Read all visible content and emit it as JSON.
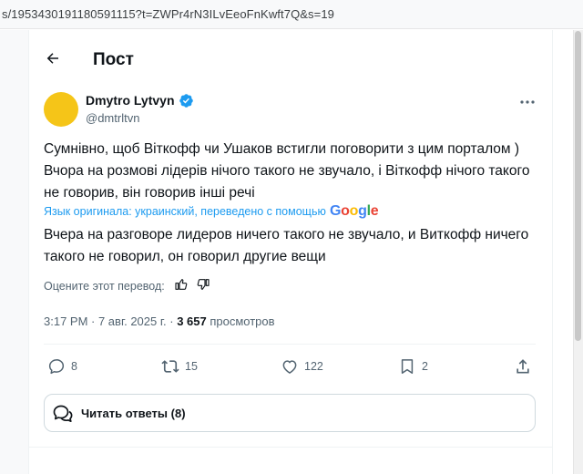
{
  "browser": {
    "url": "s/1953430191180591115?t=ZWPr4rN3ILvEeoFnKwft7Q&s=19"
  },
  "header": {
    "title": "Пост",
    "back_icon": "arrow-left-icon"
  },
  "post": {
    "author": {
      "name": "Dmytro Lytvyn",
      "handle": "@dmtrltvn",
      "verified": true,
      "avatar_color": "#f5c518"
    },
    "text": "Сумнівно, щоб Віткофф чи Ушаков встигли поговорити з цим порталом ) Вчора на розмові лідерів нічого такого не звучало, і Віткофф нічого такого не говорив, він говорив інші речі",
    "translation": {
      "note": "Язык оригинала: украинский, переведено с помощью",
      "provider": "Google",
      "text": "Вчера на разговоре лидеров ничего такого не звучало, и Виткофф ничего такого не говорил, он говорил другие вещи"
    },
    "rate_translation_label": "Оцените этот перевод:",
    "meta": {
      "time_date": "3:17 PM · 7 авг. 2025 г. · ",
      "views_count": "3 657",
      "views_label": " просмотров"
    },
    "actions": {
      "replies": "8",
      "reposts": "15",
      "likes": "122",
      "bookmarks": "2"
    },
    "read_replies_label": "Читать ответы (8)"
  },
  "colors": {
    "accent": "#1d9bf0",
    "text": "#0f1419",
    "secondary_text": "#536471",
    "border": "#cfd9de"
  }
}
